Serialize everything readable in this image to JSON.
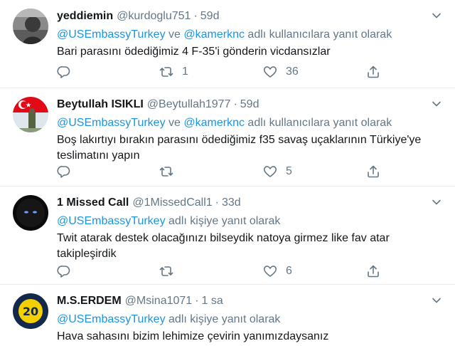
{
  "tweets": [
    {
      "name": "yeddiemin",
      "handle": "@kurdoglu751",
      "dot": "·",
      "time": "59d",
      "mention1": "@USEmbassyTurkey",
      "conj": " ve ",
      "mention2": "@kamerknc",
      "reply_suffix": " adlı kullanıcılara yanıt olarak",
      "text": "Bari parasını ödediğimiz 4 F-35'i gönderin vicdansızlar",
      "retweets": "1",
      "likes": "36"
    },
    {
      "name": "Beytullah ISIKLI",
      "handle": "@Beytullah1977",
      "dot": "·",
      "time": "59d",
      "mention1": "@USEmbassyTurkey",
      "conj": " ve ",
      "mention2": "@kamerknc",
      "reply_suffix": " adlı kullanıcılara yanıt olarak",
      "text": "Boş lakırtıyı bırakın parasını ödediğimiz f35 savaş uçaklarının Türkiye'ye teslimatını yapın",
      "retweets": "",
      "likes": "5"
    },
    {
      "name": "1 Missed Call",
      "handle": "@1MissedCall1",
      "dot": "·",
      "time": "33d",
      "mention1": "@USEmbassyTurkey",
      "reply_suffix": " adlı kişiye yanıt olarak",
      "text": "Twit atarak destek olacağınızı bilseydik natoya girmez like fav atar takipleşirdik",
      "retweets": "",
      "likes": "6"
    },
    {
      "name": "M.S.ERDEM",
      "handle": "@Msina1071",
      "dot": "·",
      "time": "1 sa",
      "mention1": "@USEmbassyTurkey",
      "reply_suffix": " adlı kişiye yanıt olarak",
      "text": "Hava sahasını bizim lehimize çevirin yanımızdaysanız"
    }
  ],
  "icons": {
    "reply": "reply-icon",
    "retweet": "retweet-icon",
    "like": "heart-icon",
    "share": "share-icon",
    "more": "chevron-down-icon"
  },
  "colors": {
    "link": "#1b95e0",
    "secondary": "#657786",
    "text": "#14171a",
    "divider": "#e6ecf0"
  }
}
